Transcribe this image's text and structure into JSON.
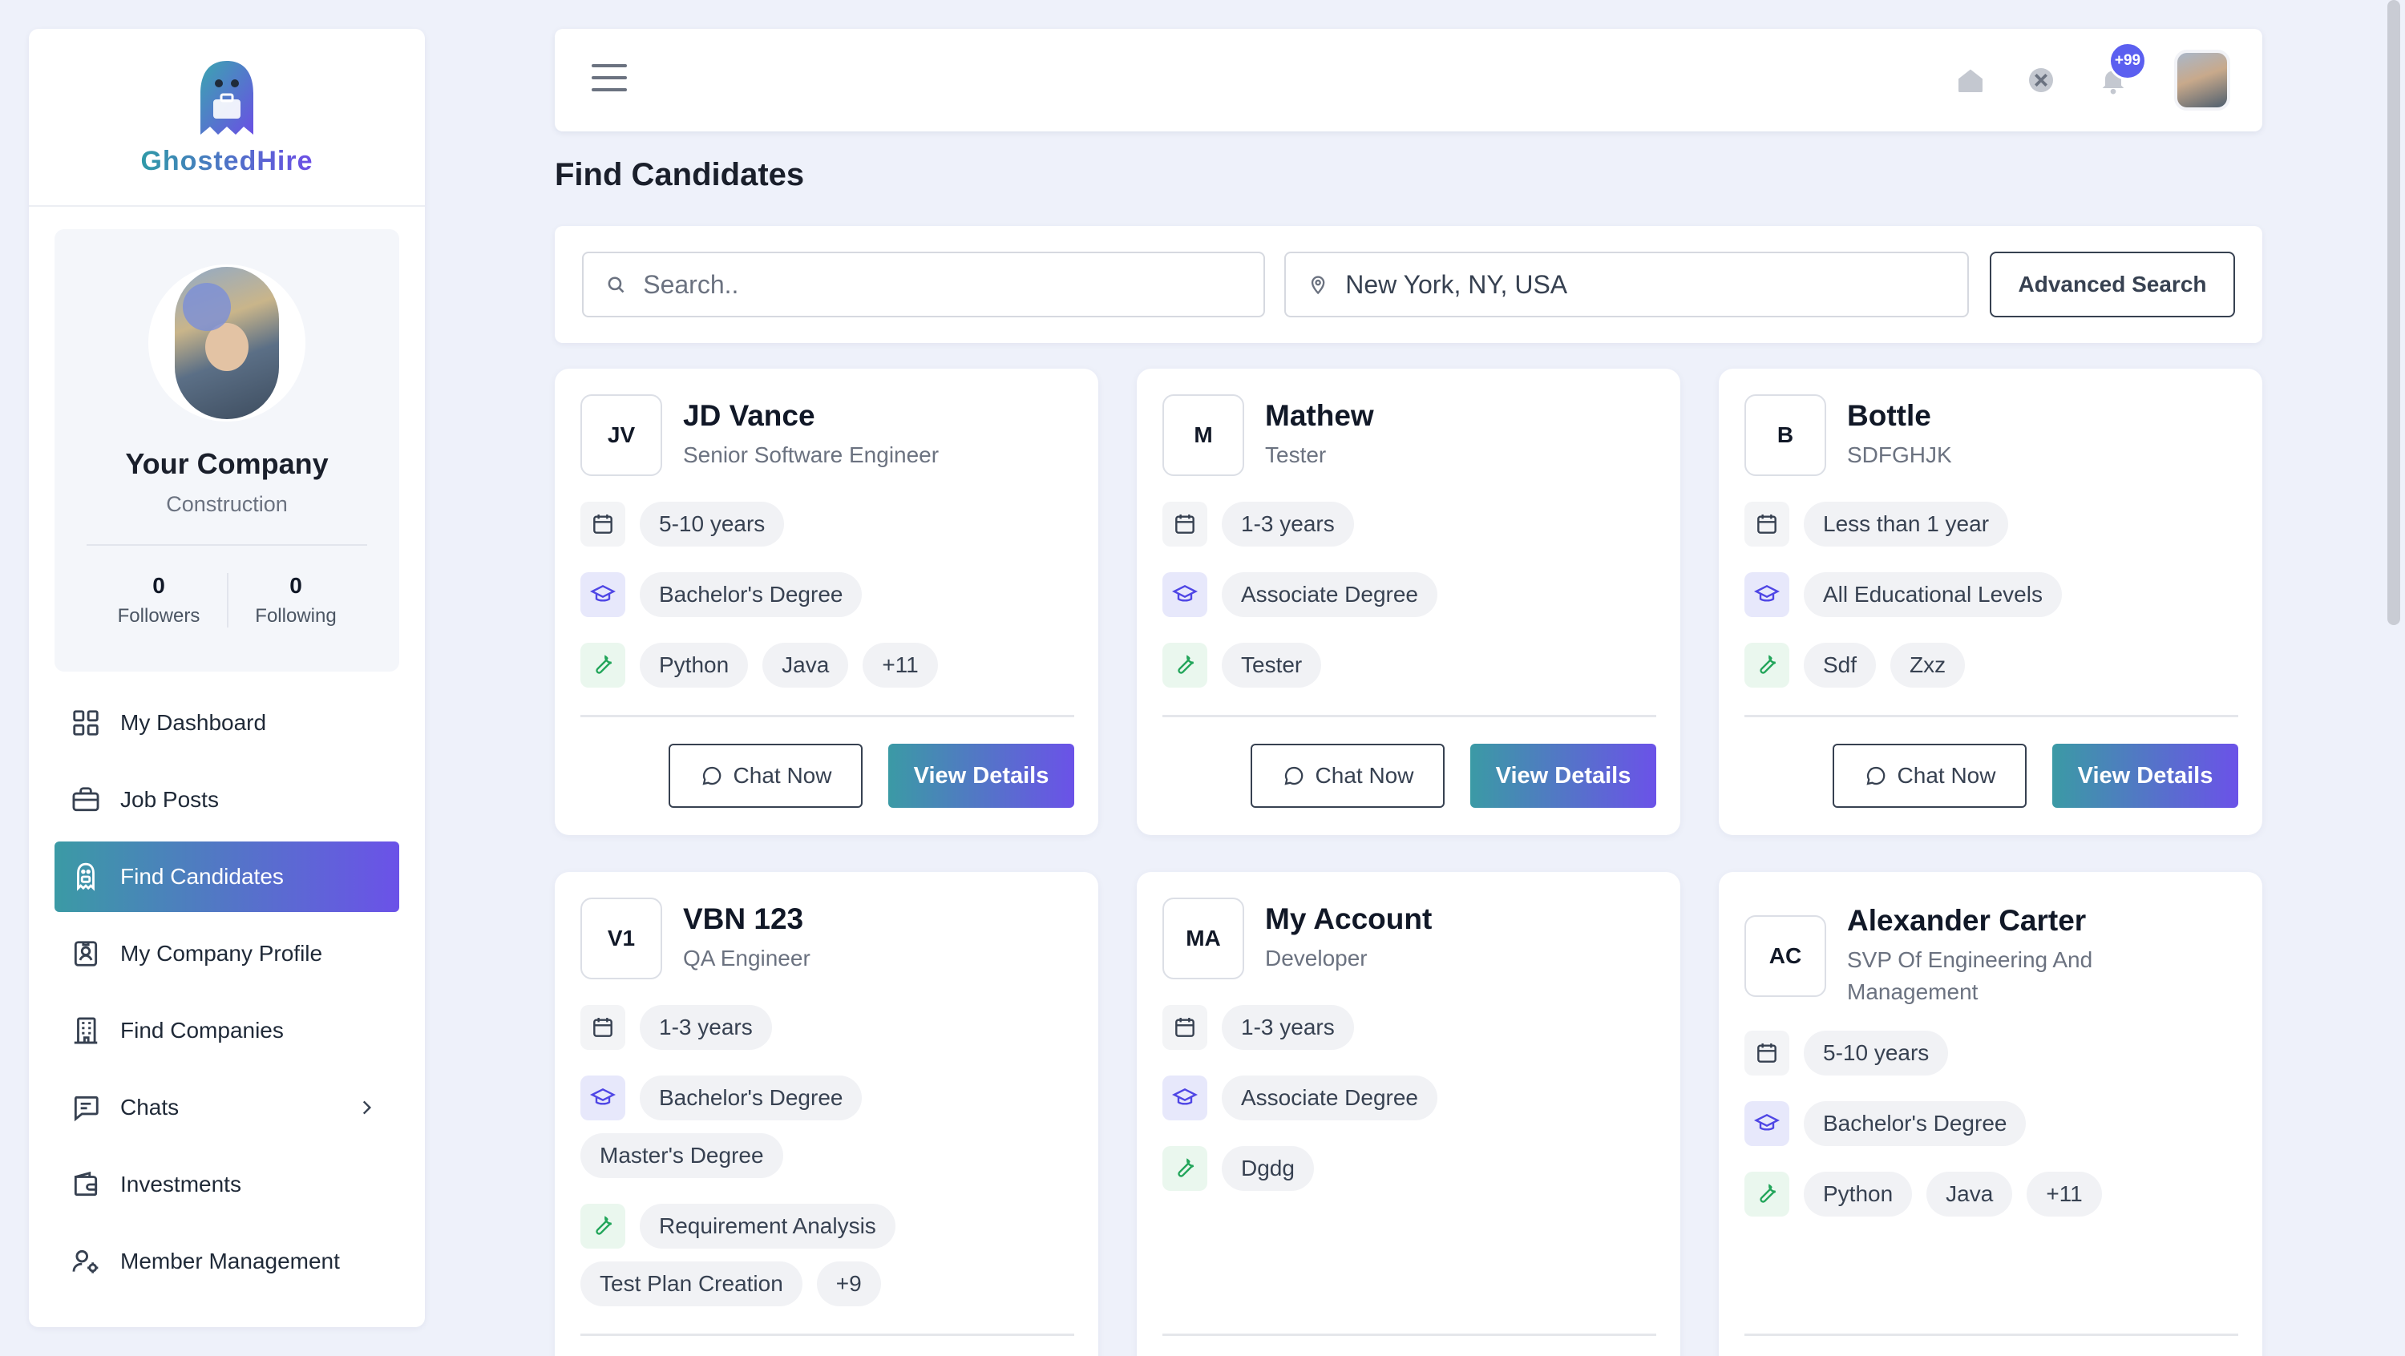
{
  "brand": {
    "name": "GhostedHire"
  },
  "profile": {
    "company": "Your Company",
    "industry": "Construction",
    "followers": {
      "count": "0",
      "label": "Followers"
    },
    "following": {
      "count": "0",
      "label": "Following"
    }
  },
  "nav": [
    {
      "label": "My Dashboard",
      "icon": "dashboard-icon"
    },
    {
      "label": "Job Posts",
      "icon": "briefcase-icon"
    },
    {
      "label": "Find Candidates",
      "icon": "ghost-icon",
      "active": true
    },
    {
      "label": "My Company Profile",
      "icon": "profile-card-icon"
    },
    {
      "label": "Find Companies",
      "icon": "building-icon"
    },
    {
      "label": "Chats",
      "icon": "chat-icon"
    },
    {
      "label": "Investments",
      "icon": "wallet-icon"
    },
    {
      "label": "Member Management",
      "icon": "user-gear-icon"
    }
  ],
  "topbar": {
    "notification_badge": "+99"
  },
  "page": {
    "title": "Find Candidates"
  },
  "search": {
    "placeholder": "Search..",
    "location_value": "New York, NY, USA",
    "advanced_label": "Advanced Search"
  },
  "actions": {
    "chat": "Chat Now",
    "view": "View Details"
  },
  "candidates": [
    {
      "initials": "JV",
      "name": "JD Vance",
      "role": "Senior Software Engineer",
      "experience": "5-10 years",
      "education": [
        "Bachelor's Degree"
      ],
      "skills": [
        "Python",
        "Java",
        "+11"
      ]
    },
    {
      "initials": "M",
      "name": "Mathew",
      "role": "Tester",
      "experience": "1-3 years",
      "education": [
        "Associate Degree"
      ],
      "skills": [
        "Tester"
      ]
    },
    {
      "initials": "B",
      "name": "Bottle",
      "role": "SDFGHJK",
      "experience": "Less than 1 year",
      "education": [
        "All Educational Levels"
      ],
      "skills": [
        "Sdf",
        "Zxz"
      ]
    },
    {
      "initials": "V1",
      "name": "VBN 123",
      "role": "QA Engineer",
      "experience": "1-3 years",
      "education": [
        "Bachelor's Degree",
        "Master's Degree"
      ],
      "skills": [
        "Requirement Analysis",
        "Test Plan Creation",
        "+9"
      ]
    },
    {
      "initials": "MA",
      "name": "My Account",
      "role": "Developer",
      "experience": "1-3 years",
      "education": [
        "Associate Degree"
      ],
      "skills": [
        "Dgdg"
      ]
    },
    {
      "initials": "AC",
      "name": "Alexander Carter",
      "role": "SVP Of Engineering And Management",
      "experience": "5-10 years",
      "education": [
        "Bachelor's Degree"
      ],
      "skills": [
        "Python",
        "Java",
        "+11"
      ]
    }
  ]
}
